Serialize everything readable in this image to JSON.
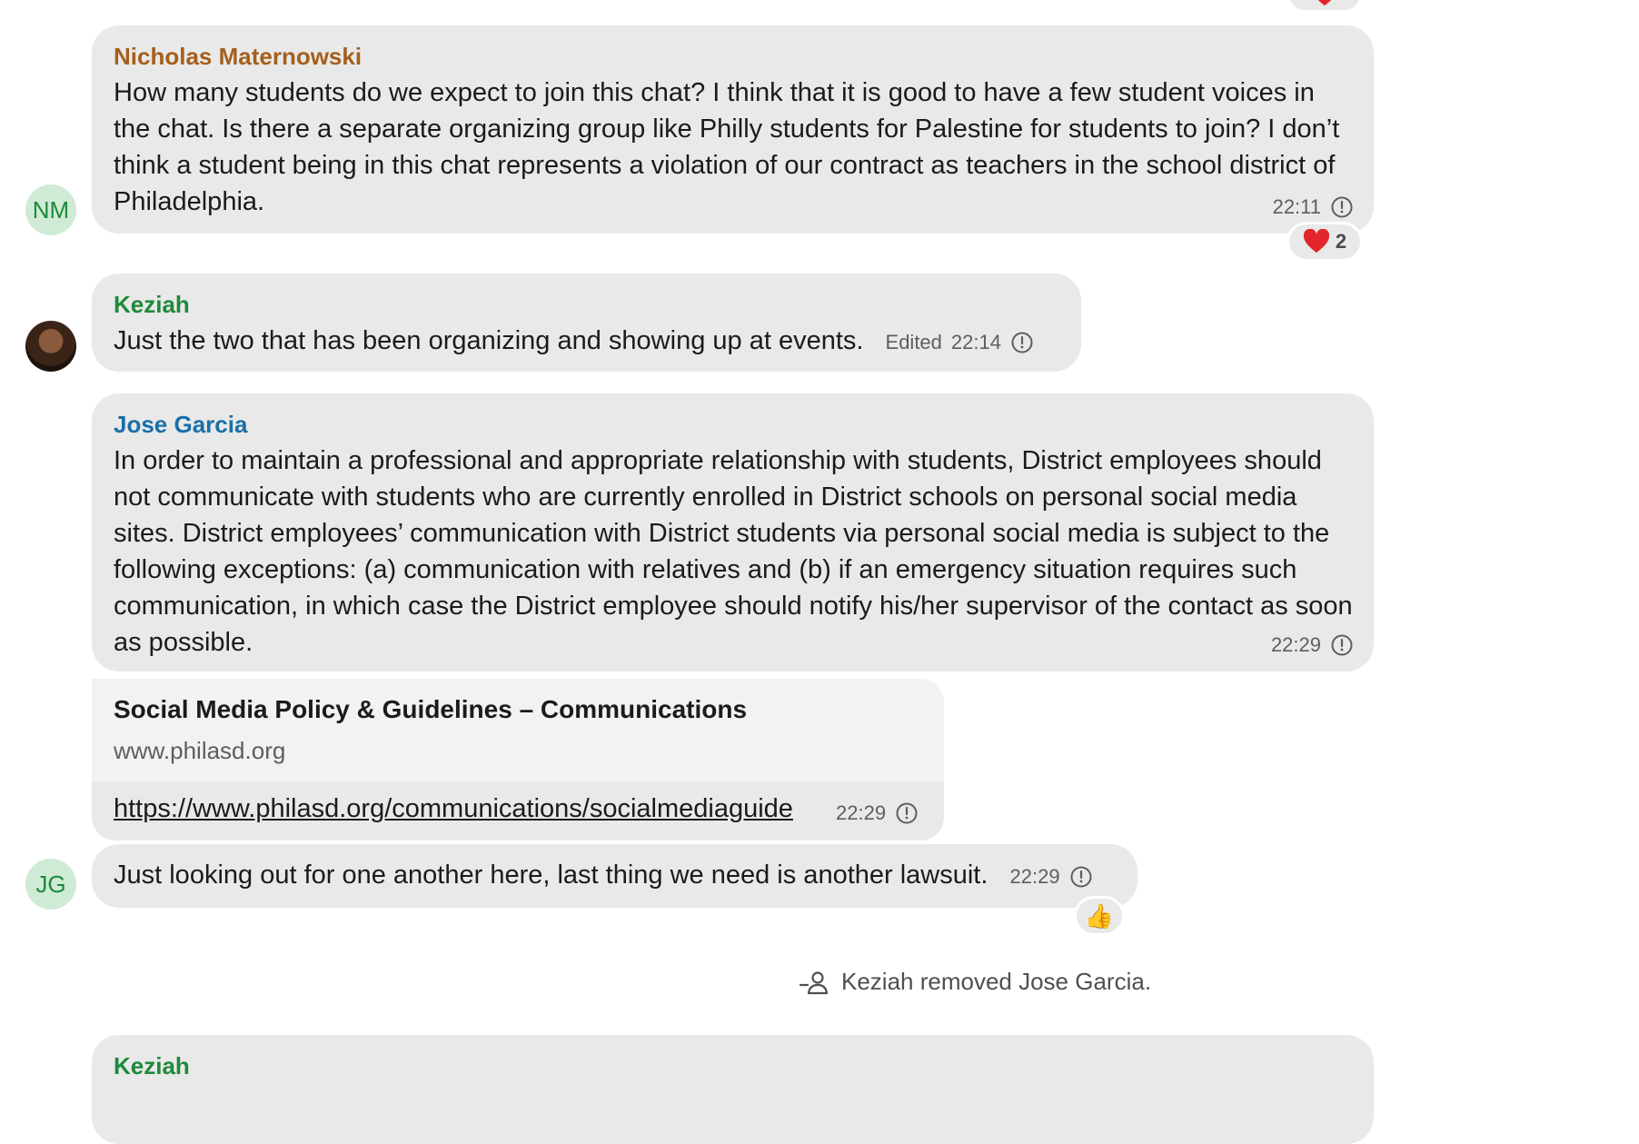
{
  "colors": {
    "nicholas": "#a55f1c",
    "keziah": "#1d8a3a",
    "jose": "#1a6fa8",
    "bubble": "#e9e9e9",
    "avatar_bg": "#cfead5"
  },
  "messages": [
    {
      "sender": "Nicholas Maternowski",
      "avatar_initials": "NM",
      "text": "How many students do we expect to join this chat? I think that it is good to have a few student voices in the chat. Is there a separate organizing group like Philly students for Palestine for students to join? I don’t think a student being in this chat represents a violation of our contract as teachers in the school district of Philadelphia.",
      "time": "22:11",
      "reaction": {
        "icon": "heart-icon",
        "count": "2"
      }
    },
    {
      "sender": "Keziah",
      "text": "Just the two that has been organizing and showing up at events.",
      "edited": "Edited",
      "time": "22:14"
    },
    {
      "sender": "Jose Garcia",
      "text": "In order to maintain a professional and appropriate relationship with students, District employees should not communicate with students who are currently enrolled in District schools on personal social media sites. District employees’ communication with District students via personal social media is subject to the following exceptions: (a) communication with relatives and (b) if an emergency situation requires such communication, in which case the District employee should notify his/her supervisor of the contact as soon as possible.",
      "time": "22:29"
    },
    {
      "link_title": "Social Media Policy & Guidelines – Communications",
      "link_domain": "www.philasd.org",
      "url": "https://www.philasd.org/communications/socialmediaguide",
      "time": "22:29"
    },
    {
      "avatar_initials": "JG",
      "text": "Just looking out for one another here, last thing we need is another lawsuit.",
      "time": "22:29",
      "reaction": {
        "icon": "thumbs-up-icon",
        "emoji": "👍"
      }
    }
  ],
  "system_notice": "Keziah removed Jose Garcia.",
  "partial_next_sender": "Keziah"
}
